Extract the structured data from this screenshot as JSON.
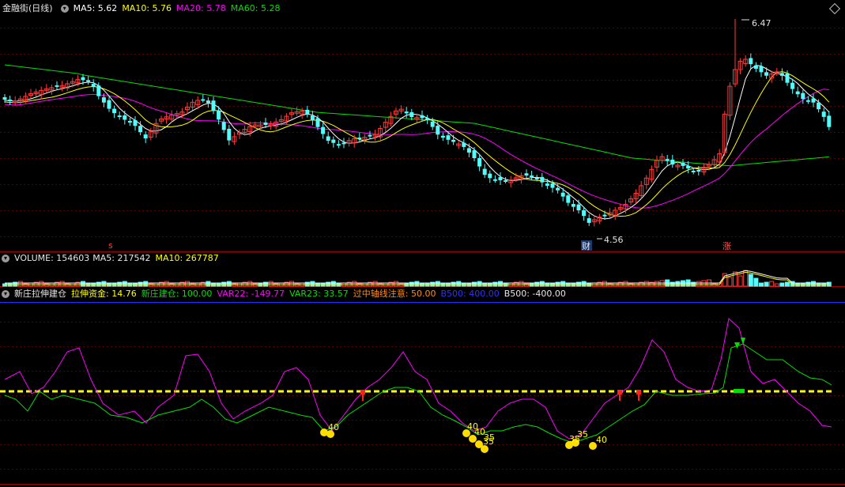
{
  "main": {
    "title": "金融街(日线)",
    "ma5": "MA5: 5.62",
    "ma10": "MA10: 5.76",
    "ma20": "MA20: 5.78",
    "ma60": "MA60: 5.28",
    "high_label": "6.47",
    "low_label": "4.56",
    "marker_s": "s",
    "marker_cai": "财",
    "marker_zhang": "涨"
  },
  "volume": {
    "label": "VOLUME: 154603",
    "ma5": "MA5: 217542",
    "ma10": "MA10: 267787"
  },
  "indicator": {
    "name": "新庄拉伸建仓",
    "lashen": "拉伸资金: 14.76",
    "jiancang": "新庄建仓: 100.00",
    "var22": "VAR22: -149.77",
    "var23": "VAR23: 33.57",
    "guozhong": "过中轴线注意: 50.00",
    "b500pos": "B500: 400.00",
    "b500neg": "B500: -400.00",
    "dot_labels": [
      "40",
      "40",
      "40",
      "35",
      "35",
      "35",
      "40",
      "35"
    ]
  },
  "colors": {
    "up": "#ff3c3c",
    "down": "#54fcfc",
    "ma5": "#ffffff",
    "ma10": "#ffff00",
    "ma20": "#ff00ff",
    "ma60": "#00e000"
  }
}
